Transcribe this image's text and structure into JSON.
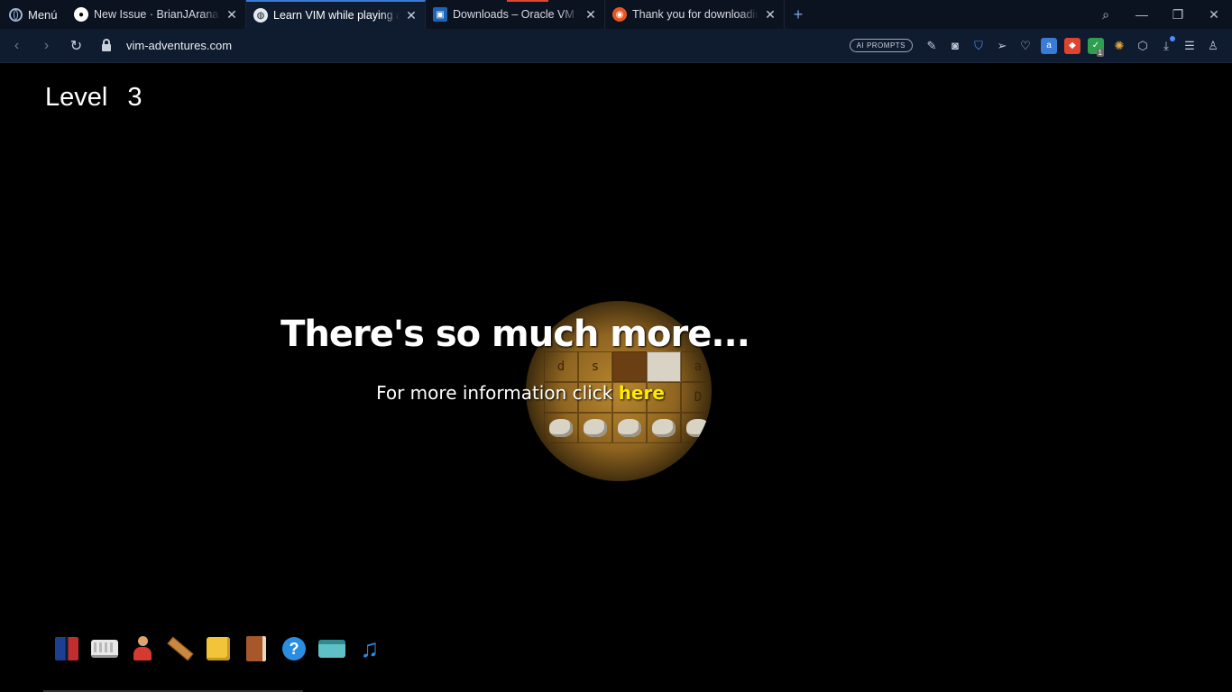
{
  "browser": {
    "menu_label": "Menú",
    "tabs": [
      {
        "title": "New Issue · BrianJAranaZ/P",
        "icon": "github-icon",
        "active": false
      },
      {
        "title": "Learn VIM while playing a g",
        "icon": "globe-icon",
        "active": true
      },
      {
        "title": "Downloads – Oracle VM Vir",
        "icon": "virtualbox-icon",
        "active": false
      },
      {
        "title": "Thank you for downloading",
        "icon": "ubuntu-icon",
        "active": false
      }
    ],
    "url": "vim-adventures.com",
    "ai_prompts_label": "AI PROMPTS",
    "extension_badge": "1"
  },
  "game": {
    "level_label": "Level",
    "level_number": "3",
    "headline": "There's so much more...",
    "info_text": "For more information click ",
    "info_link": "here",
    "board_letters_row1": [
      "d",
      "s",
      "",
      "",
      "a",
      "r"
    ],
    "board_letters_row2": [
      "",
      "",
      "",
      "",
      "",
      "D"
    ],
    "toolbar_icons": [
      "books-icon",
      "keyboard-icon",
      "character-icon",
      "ruler-icon",
      "puzzle-icon",
      "diary-icon",
      "help-icon",
      "card-icon",
      "music-icon"
    ]
  }
}
